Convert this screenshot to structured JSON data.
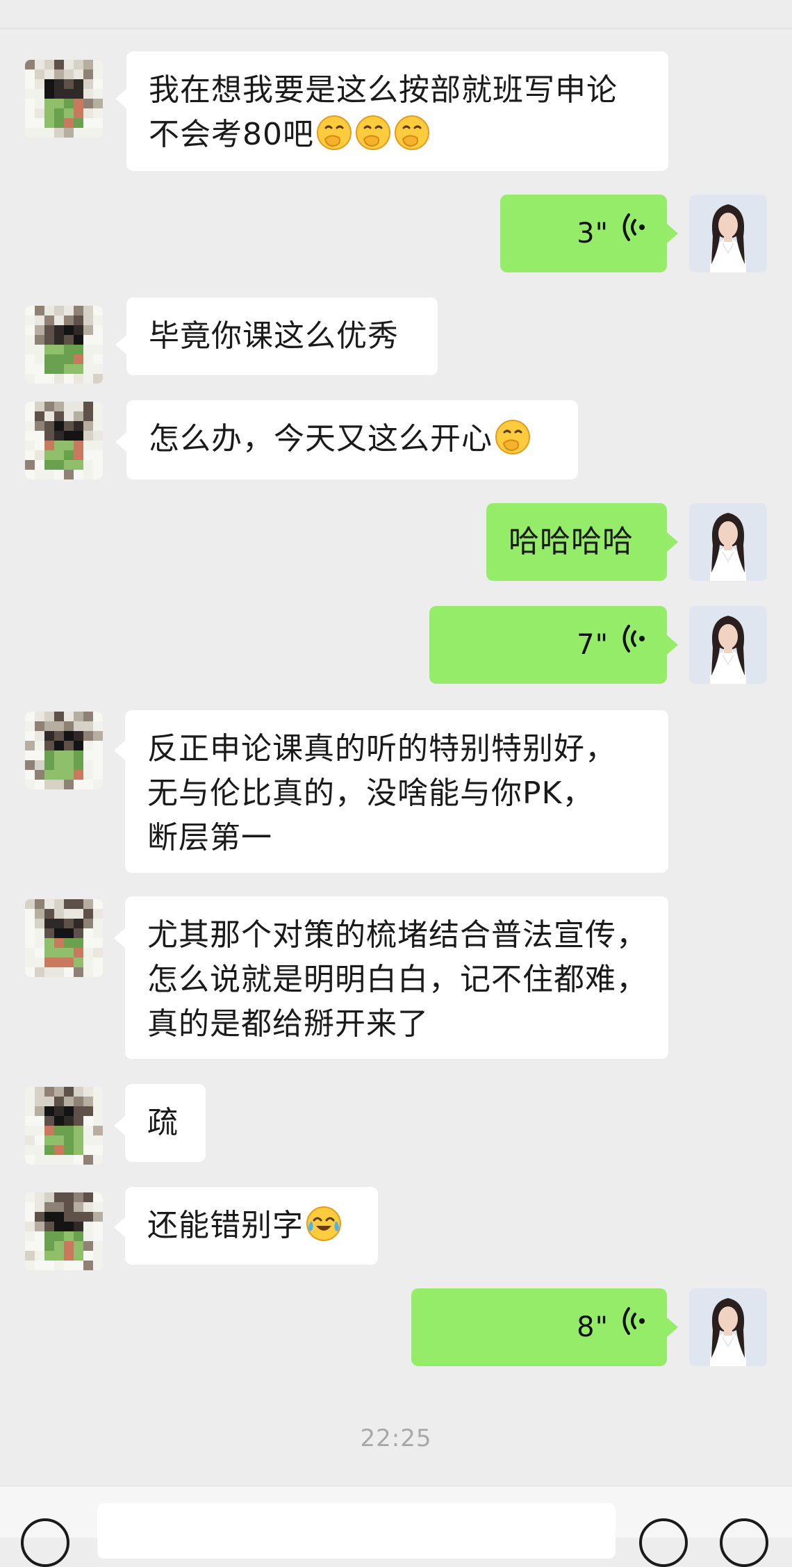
{
  "messages": [
    {
      "side": "left",
      "lines": [
        "我在想我要是这么按部就班写申论",
        "不会考80吧"
      ],
      "emoji_count": 3
    },
    {
      "side": "right",
      "type": "voice",
      "duration": "3\""
    },
    {
      "side": "left",
      "lines": [
        "毕竟你课这么优秀"
      ],
      "emoji_count": 0
    },
    {
      "side": "left",
      "lines": [
        "怎么办，今天又这么开心"
      ],
      "emoji_count": 1
    },
    {
      "side": "right",
      "type": "text",
      "text": "哈哈哈哈"
    },
    {
      "side": "right",
      "type": "voice",
      "duration": "7\""
    },
    {
      "side": "left",
      "lines": [
        "反正申论课真的听的特别特别好，",
        "无与伦比真的，没啥能与你PK，",
        "断层第一"
      ],
      "emoji_count": 0
    },
    {
      "side": "left",
      "lines": [
        "尤其那个对策的梳堵结合普法宣传，",
        "怎么说就是明明白白，记不住都难，",
        "真的是都给掰开来了"
      ],
      "emoji_count": 0
    },
    {
      "side": "left",
      "lines": [
        "疏"
      ],
      "emoji_count": 0
    },
    {
      "side": "left",
      "lines": [
        "还能错别字"
      ],
      "emoji_count": 1
    },
    {
      "side": "right",
      "type": "voice",
      "duration": "8\""
    }
  ],
  "timestamp": "22:25",
  "icons": {
    "voice": "voice-wave-icon",
    "emoji_thinking": "hand-over-mouth-emoji",
    "emoji_cry": "laugh-cry-emoji"
  },
  "colors": {
    "background": "#ededed",
    "bubble_self": "#95ec69",
    "bubble_other": "#ffffff"
  }
}
